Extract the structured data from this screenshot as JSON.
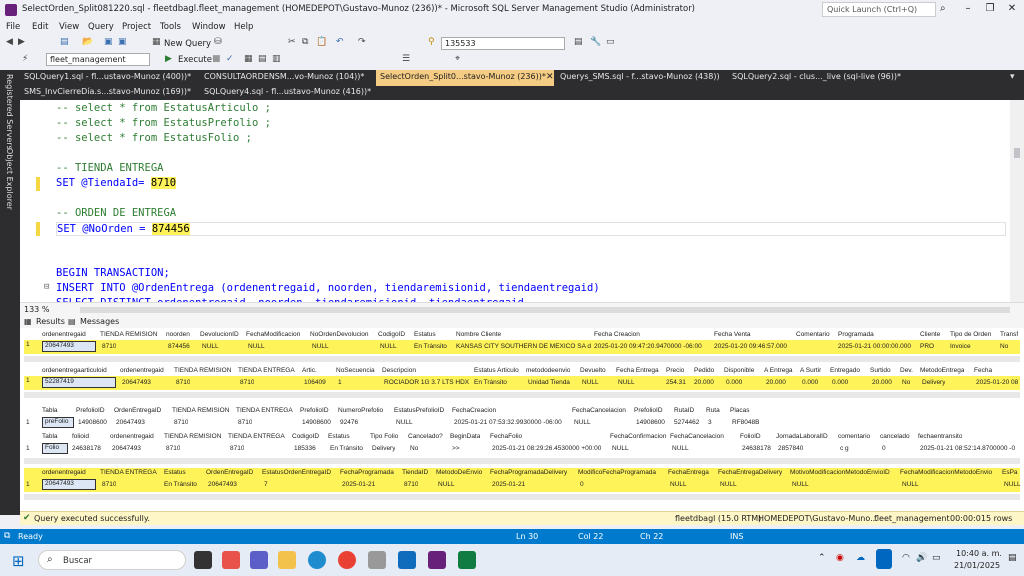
{
  "title": "SelectOrden_Split081220.sql - fleetdbagl.fleet_management (HOMEDEPOT\\Gustavo-Munoz (236))* - Microsoft SQL Server Management Studio (Administrator)",
  "quick_launch": "Quick Launch (Ctrl+Q)",
  "menu": [
    "File",
    "Edit",
    "View",
    "Query",
    "Project",
    "Tools",
    "Window",
    "Help"
  ],
  "toolbar": {
    "new_query": "New Query",
    "combo_value": "135533",
    "db": "fleet_management",
    "execute": "Execute"
  },
  "sidebar": [
    "Registered Servers",
    "Object Explorer"
  ],
  "tabs_row1": [
    "SQLQuery1.sql - fl...ustavo-Munoz (400))*",
    "CONSULTAORDENSM...vo-Munoz (104))*",
    "SelectOrden_Split0...stavo-Munoz (236))*",
    "Querys_SMS.sql - f...stavo-Munoz (438))",
    "SQLQuery2.sql - clus..._live (sql-live (96))*"
  ],
  "tabs_row2": [
    "SMS_InvCierreDía.s...stavo-Munoz (169))*",
    "SQLQuery4.sql - fl...ustavo-Munoz (416))*"
  ],
  "code": {
    "l1": "-- select * from EstatusArticulo ;",
    "l2": "-- select * from EstatusPrefolio ;",
    "l3": "-- select * from EstatusFolio ;",
    "l4": "-- TIENDA ENTREGA",
    "l5a": "SET @TiendaId= ",
    "l5b": "8710",
    "l6": "-- ORDEN DE ENTREGA",
    "l7a": "SET @NoOrden = ",
    "l7b": "874456",
    "l8": "BEGIN TRANSACTION;",
    "l9": "INSERT INTO @OrdenEntrega (ordenentregaid, noorden, tiendaremisionid, tiendaentregaid)",
    "l10": "SELECT DISTINCT ordenentregaid, noorden, tiendaremisionid, tiendaentregaid"
  },
  "zoom": "133 %",
  "results_tabs": [
    "Results",
    "Messages"
  ],
  "grid1": {
    "headers": [
      "ordenentregaid",
      "TIENDA REMISIÓN",
      "noorden",
      "DevolucionID",
      "FechaModificacion",
      "NoOrdenDevolucion",
      "CodigoID",
      "Estatus",
      "Nombre Cliente",
      "Fecha Creacion",
      "Fecha Venta",
      "Comentario",
      "Programada",
      "Cliente",
      "Tipo de Orden",
      "Transf"
    ],
    "row": [
      "1",
      "20647493",
      "8710",
      "874456",
      "NULL",
      "NULL",
      "NULL",
      "NULL",
      "En Tránsito",
      "KANSAS CITY SOUTHERN DE MEXICO SA d",
      "2025-01-20 09:47:20.9470000 -06:00",
      "2025-01-20 09:46:57.000",
      "",
      "2025-01-21 00:00:00.000",
      "PRO",
      "Invoice",
      "No"
    ]
  },
  "grid2": {
    "headers": [
      "ordenentregaarticuloid",
      "ordenentregaid",
      "TIENDA REMISIÓN",
      "TIENDA ENTREGA",
      "Artic.",
      "NoSecuencia",
      "Descripcion",
      "Estatus Articulo",
      "metododeenvio",
      "Devuelto",
      "Fecha Entrega",
      "Precio",
      "Pedido",
      "Disponible",
      "A Entrega",
      "A Surtir",
      "Entregado",
      "Surtido",
      "Dev.",
      "MetodoEntrega",
      "Fecha"
    ],
    "row": [
      "1",
      "52287419",
      "20647493",
      "8710",
      "8710",
      "106409",
      "1",
      "ROCIADOR 1G 3.7 LTS HDX",
      "En Tránsito",
      "Unidad Tienda",
      "NULL",
      "NULL",
      "254.31",
      "20.000",
      "0.000",
      "20.000",
      "0.000",
      "0.000",
      "20.000",
      "No",
      "Delivery",
      "2025-01-20 08"
    ]
  },
  "grid3": {
    "headers": [
      "Tabla",
      "PrefolioID",
      "OrdenEntregaID",
      "TIENDA REMISIÓN",
      "TIENDA ENTREGA",
      "PrefolioID",
      "NumeroPrefolio",
      "EstatusPrefolioID",
      "FechaCreacion",
      "FechaCancelacion",
      "PrefolioID",
      "RutaID",
      "Ruta",
      "Placas"
    ],
    "row": [
      "1",
      "preFolio",
      "14908600",
      "20647493",
      "8710",
      "8710",
      "14908600",
      "92476",
      "NULL",
      "2025-01-21 07:53:32.9930000 -06:00",
      "NULL",
      "14908600",
      "5274462",
      "3",
      "RF8048B"
    ]
  },
  "grid4": {
    "headers": [
      "Tabla",
      "folioid",
      "ordenentregaid",
      "TIENDA REMISIÓN",
      "TIENDA ENTREGA",
      "CodigoID",
      "Estatus",
      "Tipo Folio",
      "Cancelado?",
      "BeginData",
      "FechaFolio",
      "FechaConfirmacion",
      "FechaCancelacion",
      "FolioID",
      "JornadaLaboralID",
      "comentario",
      "cancelado",
      "fechaentransito"
    ],
    "row": [
      "1",
      "Folio",
      "24638178",
      "20647493",
      "8710",
      "8710",
      "185336",
      "En Tránsito",
      "Delivery",
      "No",
      ">>",
      "2025-01-21 08:29:26.4530000 +00:00",
      "NULL",
      "NULL",
      "24638178",
      "2857840",
      "c g",
      "0",
      "2025-01-21 08:52:14.8700000 -0"
    ]
  },
  "grid5": {
    "headers": [
      "ordenentregaid",
      "TIENDA ENTREGA",
      "Estatus",
      "OrdenEntregaID",
      "EstatusOrdenEntregaID",
      "FechaProgramada",
      "TiendaID",
      "MetodoDeEnvio",
      "FechaProgramadaDelivery",
      "ModificoFechaProgramada",
      "FechaEntrega",
      "FechaEntregaDelivery",
      "MotivoModificacionMetodoEnvioID",
      "FechaModificacionMetodoEnvio",
      "EsPa"
    ],
    "row": [
      "1",
      "20647493",
      "8710",
      "En Tránsito",
      "20647493",
      "7",
      "2025-01-21",
      "8710",
      "NULL",
      "2025-01-21",
      "0",
      "NULL",
      "NULL",
      "NULL",
      "NULL",
      "NULL"
    ]
  },
  "status": {
    "msg": "Query executed successfully.",
    "server": "fleetdbagl (15.0 RTM)",
    "user": "HOMEDEPOT\\Gustavo-Muno...",
    "db": "fleet_management",
    "time": "00:00:01",
    "rows": "5 rows"
  },
  "ready": {
    "label": "Ready",
    "ln": "Ln 30",
    "col": "Col 22",
    "ch": "Ch 22",
    "ins": "INS"
  },
  "taskbar": {
    "search": "Buscar",
    "time": "10:40 a. m.",
    "date": "21/01/2025"
  }
}
